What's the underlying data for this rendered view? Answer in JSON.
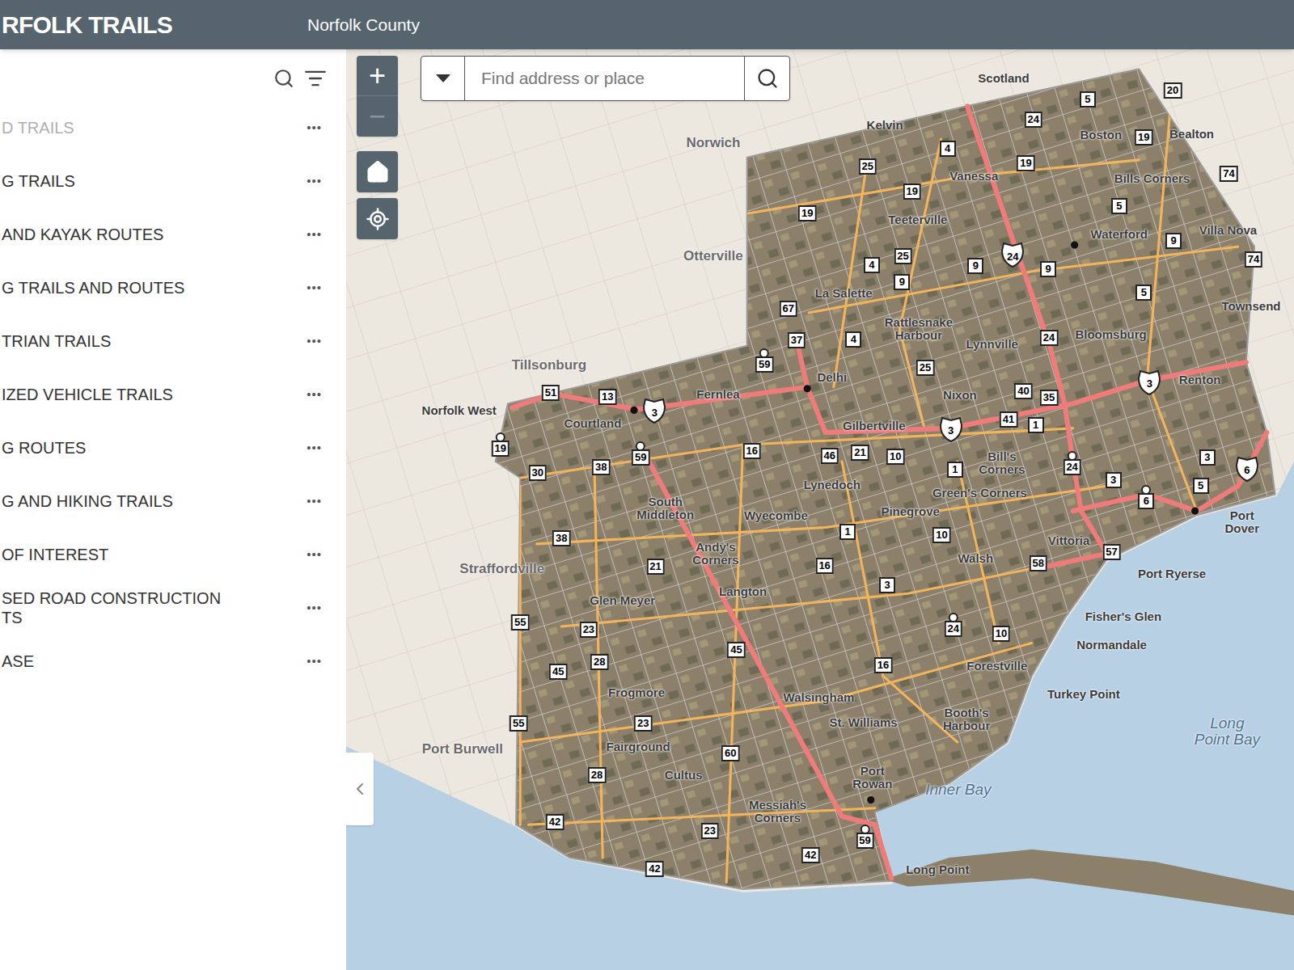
{
  "header": {
    "title": "RFOLK TRAILS",
    "subtitle": "Norfolk County"
  },
  "sidebar": {
    "menu_glyph": "•••",
    "items": [
      {
        "label": "D TRAILS",
        "disabled": true
      },
      {
        "label": "G TRAILS",
        "disabled": false
      },
      {
        "label": "AND KAYAK ROUTES",
        "disabled": false
      },
      {
        "label": "G TRAILS AND ROUTES",
        "disabled": false
      },
      {
        "label": "TRIAN TRAILS",
        "disabled": false
      },
      {
        "label": "IZED VEHICLE TRAILS",
        "disabled": false
      },
      {
        "label": "G ROUTES",
        "disabled": false
      },
      {
        "label": "G AND HIKING TRAILS",
        "disabled": false
      },
      {
        "label": "OF INTEREST",
        "disabled": false
      },
      {
        "label": "SED ROAD CONSTRUCTION\nTS",
        "disabled": false
      },
      {
        "label": "ASE",
        "disabled": false
      }
    ]
  },
  "zoom": {
    "in": "+",
    "out": "−",
    "out_disabled": true
  },
  "search": {
    "placeholder": "Find address or place"
  },
  "places": [
    {
      "text": "Scotland",
      "kind": "town"
    },
    {
      "text": "Kelvin",
      "kind": "town"
    },
    {
      "text": "Norwich",
      "kind": "outside"
    },
    {
      "text": "Vanessa",
      "kind": "town"
    },
    {
      "text": "Boston",
      "kind": "town"
    },
    {
      "text": "Bealton",
      "kind": "town"
    },
    {
      "text": "Bills Corners",
      "kind": "town"
    },
    {
      "text": "Teeterville",
      "kind": "town"
    },
    {
      "text": "Waterford",
      "kind": "town"
    },
    {
      "text": "Villa Nova",
      "kind": "town"
    },
    {
      "text": "Otterville",
      "kind": "outside"
    },
    {
      "text": "La Salette",
      "kind": "town"
    },
    {
      "text": "Rattlesnake\nHarbour",
      "kind": "town"
    },
    {
      "text": "Lynnville",
      "kind": "town"
    },
    {
      "text": "Bloomsburg",
      "kind": "town"
    },
    {
      "text": "Townsend",
      "kind": "town"
    },
    {
      "text": "Tillsonburg",
      "kind": "outside"
    },
    {
      "text": "Delhi",
      "kind": "town"
    },
    {
      "text": "Fernlea",
      "kind": "town"
    },
    {
      "text": "Nixon",
      "kind": "town"
    },
    {
      "text": "Renton",
      "kind": "town"
    },
    {
      "text": "Norfolk West",
      "kind": "town"
    },
    {
      "text": "Courtland",
      "kind": "town"
    },
    {
      "text": "Gilbertville",
      "kind": "town"
    },
    {
      "text": "Bill's\nCorners",
      "kind": "town"
    },
    {
      "text": "Lynedoch",
      "kind": "town"
    },
    {
      "text": "Green's Corners",
      "kind": "town"
    },
    {
      "text": "South\nMiddleton",
      "kind": "town"
    },
    {
      "text": "Wyecombe",
      "kind": "town"
    },
    {
      "text": "Pinegrove",
      "kind": "town"
    },
    {
      "text": "Port Dover",
      "kind": "town"
    },
    {
      "text": "Vittoria",
      "kind": "town"
    },
    {
      "text": "Walsh",
      "kind": "town"
    },
    {
      "text": "Port Ryerse",
      "kind": "town"
    },
    {
      "text": "Andy's\nCorners",
      "kind": "town"
    },
    {
      "text": "Straffordville",
      "kind": "outside"
    },
    {
      "text": "Langton",
      "kind": "town"
    },
    {
      "text": "Glen Meyer",
      "kind": "town"
    },
    {
      "text": "Fisher's Glen",
      "kind": "town"
    },
    {
      "text": "Normandale",
      "kind": "town"
    },
    {
      "text": "Forestville",
      "kind": "town"
    },
    {
      "text": "Frogmore",
      "kind": "town"
    },
    {
      "text": "Turkey Point",
      "kind": "town"
    },
    {
      "text": "Walsingham",
      "kind": "town"
    },
    {
      "text": "St. Williams",
      "kind": "town"
    },
    {
      "text": "Booth's\nHarbour",
      "kind": "town"
    },
    {
      "text": "Long\nPoint Bay",
      "kind": "water"
    },
    {
      "text": "Fairground",
      "kind": "town"
    },
    {
      "text": "Port Burwell",
      "kind": "outside"
    },
    {
      "text": "Cultus",
      "kind": "town"
    },
    {
      "text": "Port\nRowan",
      "kind": "town"
    },
    {
      "text": "Inner Bay",
      "kind": "water"
    },
    {
      "text": "Messiah's\nCorners",
      "kind": "town"
    },
    {
      "text": "Long Point",
      "kind": "town"
    }
  ],
  "shields": [
    {
      "number": "20",
      "kind": "county"
    },
    {
      "number": "5",
      "kind": "county"
    },
    {
      "number": "24",
      "kind": "county"
    },
    {
      "number": "19",
      "kind": "county"
    },
    {
      "number": "74",
      "kind": "county"
    },
    {
      "number": "4",
      "kind": "county"
    },
    {
      "number": "25",
      "kind": "county"
    },
    {
      "number": "19",
      "kind": "county"
    },
    {
      "number": "19",
      "kind": "county"
    },
    {
      "number": "5",
      "kind": "county"
    },
    {
      "number": "19",
      "kind": "county"
    },
    {
      "number": "24",
      "kind": "highway"
    },
    {
      "number": "9",
      "kind": "county"
    },
    {
      "number": "74",
      "kind": "county"
    },
    {
      "number": "4",
      "kind": "county"
    },
    {
      "number": "25",
      "kind": "county"
    },
    {
      "number": "9",
      "kind": "county"
    },
    {
      "number": "9",
      "kind": "county"
    },
    {
      "number": "9",
      "kind": "county"
    },
    {
      "number": "5",
      "kind": "county"
    },
    {
      "number": "67",
      "kind": "county"
    },
    {
      "number": "37",
      "kind": "county"
    },
    {
      "number": "4",
      "kind": "county"
    },
    {
      "number": "24",
      "kind": "county"
    },
    {
      "number": "59",
      "kind": "secondary"
    },
    {
      "number": "25",
      "kind": "county"
    },
    {
      "number": "3",
      "kind": "highway"
    },
    {
      "number": "40",
      "kind": "county"
    },
    {
      "number": "35",
      "kind": "county"
    },
    {
      "number": "51",
      "kind": "county"
    },
    {
      "number": "13",
      "kind": "county"
    },
    {
      "number": "3",
      "kind": "highway"
    },
    {
      "number": "3",
      "kind": "highway"
    },
    {
      "number": "41",
      "kind": "county"
    },
    {
      "number": "1",
      "kind": "county"
    },
    {
      "number": "19",
      "kind": "secondary"
    },
    {
      "number": "59",
      "kind": "secondary"
    },
    {
      "number": "16",
      "kind": "county"
    },
    {
      "number": "46",
      "kind": "county"
    },
    {
      "number": "21",
      "kind": "county"
    },
    {
      "number": "10",
      "kind": "county"
    },
    {
      "number": "24",
      "kind": "secondary"
    },
    {
      "number": "1",
      "kind": "county"
    },
    {
      "number": "3",
      "kind": "county"
    },
    {
      "number": "6",
      "kind": "highway"
    },
    {
      "number": "3",
      "kind": "county"
    },
    {
      "number": "6",
      "kind": "secondary"
    },
    {
      "number": "5",
      "kind": "county"
    },
    {
      "number": "30",
      "kind": "county"
    },
    {
      "number": "38",
      "kind": "county"
    },
    {
      "number": "38",
      "kind": "county"
    },
    {
      "number": "1",
      "kind": "county"
    },
    {
      "number": "10",
      "kind": "county"
    },
    {
      "number": "21",
      "kind": "county"
    },
    {
      "number": "16",
      "kind": "county"
    },
    {
      "number": "3",
      "kind": "county"
    },
    {
      "number": "57",
      "kind": "county"
    },
    {
      "number": "58",
      "kind": "county"
    },
    {
      "number": "55",
      "kind": "county"
    },
    {
      "number": "23",
      "kind": "county"
    },
    {
      "number": "24",
      "kind": "secondary"
    },
    {
      "number": "10",
      "kind": "county"
    },
    {
      "number": "45",
      "kind": "county"
    },
    {
      "number": "28",
      "kind": "county"
    },
    {
      "number": "45",
      "kind": "county"
    },
    {
      "number": "16",
      "kind": "county"
    },
    {
      "number": "55",
      "kind": "county"
    },
    {
      "number": "23",
      "kind": "county"
    },
    {
      "number": "60",
      "kind": "county"
    },
    {
      "number": "28",
      "kind": "county"
    },
    {
      "number": "42",
      "kind": "county"
    },
    {
      "number": "23",
      "kind": "county"
    },
    {
      "number": "42",
      "kind": "county"
    },
    {
      "number": "59",
      "kind": "secondary"
    },
    {
      "number": "42",
      "kind": "county"
    }
  ]
}
